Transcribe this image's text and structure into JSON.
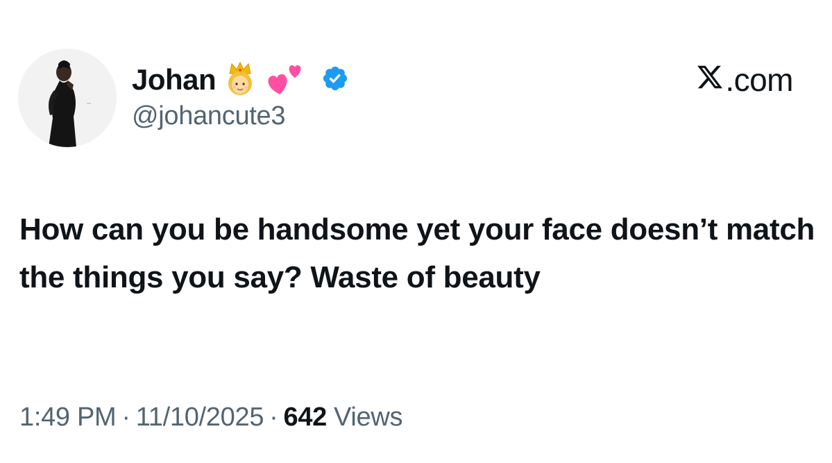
{
  "author": {
    "display_name": "Johan",
    "name_emojis": [
      "princess-emoji",
      "two-hearts-emoji"
    ],
    "verified_icon": "verified-badge-icon",
    "handle": "@johancute3"
  },
  "source": {
    "label": ".com",
    "logo_icon": "x-logo-icon"
  },
  "tweet": {
    "text": "How can you be handsome yet your face doesn’t match the things you say? Waste of beauty"
  },
  "meta": {
    "time": "1:49 PM",
    "separator": "·",
    "date": "11/10/2025",
    "views_count": "642",
    "views_label": "Views"
  },
  "colors": {
    "text_primary": "#0f1419",
    "text_secondary": "#536471",
    "verified_blue": "#1d9bf0",
    "background": "#ffffff"
  }
}
